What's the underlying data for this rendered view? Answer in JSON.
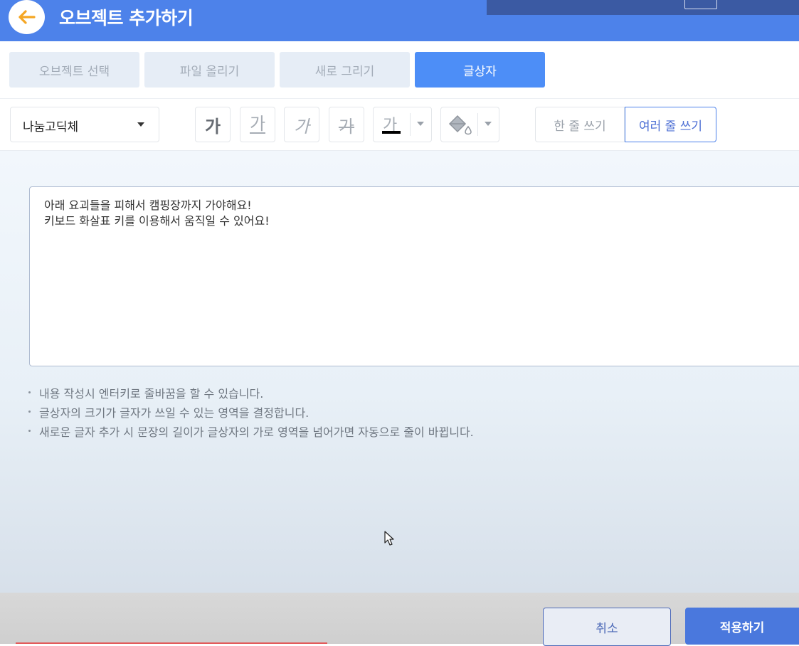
{
  "header": {
    "title": "오브젝트 추가하기",
    "accent_color": "#4d82ea",
    "back_icon": "arrow-left-icon"
  },
  "tabs": [
    {
      "label": "오브젝트 선택",
      "active": false
    },
    {
      "label": "파일 올리기",
      "active": false
    },
    {
      "label": "새로 그리기",
      "active": false
    },
    {
      "label": "글상자",
      "active": true
    }
  ],
  "toolbar": {
    "font_family_value": "나눔고딕체",
    "bold_label": "가",
    "underline_label": "가",
    "italic_label": "가",
    "strike_label": "가",
    "text_color_label": "가",
    "text_color": "#000000",
    "fill_icon": "paint-bucket-icon",
    "single_line_label": "한 줄 쓰기",
    "multi_line_label": "여러 줄 쓰기"
  },
  "textbox": {
    "value": "아래 요괴들을 피해서 캠핑장까지 가야해요!\n키보드 화살표 키를 이용해서 움직일 수 있어요!"
  },
  "tips": [
    "내용 작성시 엔터키로 줄바꿈을 할 수 있습니다.",
    "글상자의 크기가 글자가 쓰일 수 있는 영역을 결정합니다.",
    "새로운 글자 추가 시 문장의 길이가 글상자의 가로 영역을 넘어가면 자동으로 줄이 바뀝니다."
  ],
  "footer": {
    "cancel_label": "취소",
    "apply_label": "적용하기"
  }
}
